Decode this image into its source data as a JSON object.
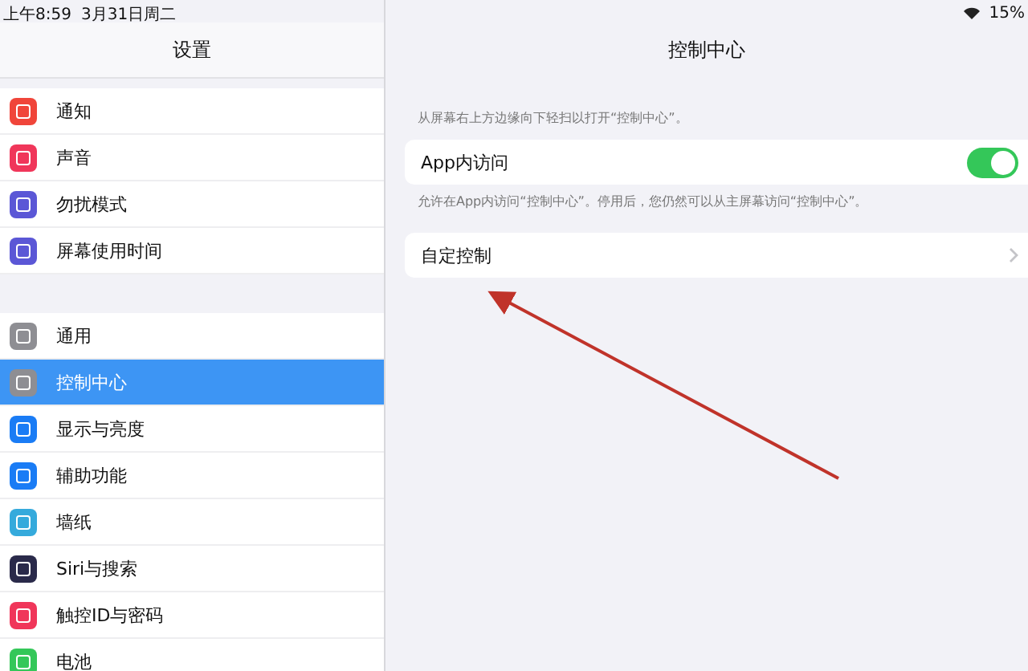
{
  "status_bar": {
    "time": "上午8:59",
    "date": "3月31日周二",
    "battery": "15%"
  },
  "sidebar": {
    "title": "设置",
    "groups": [
      [
        {
          "label": "通知",
          "color": "#f0453a",
          "selected": false
        },
        {
          "label": "声音",
          "color": "#f0365a",
          "selected": false
        },
        {
          "label": "勿扰模式",
          "color": "#5b57d6",
          "selected": false
        },
        {
          "label": "屏幕使用时间",
          "color": "#5b57d6",
          "selected": false
        }
      ],
      [
        {
          "label": "通用",
          "color": "#8e8e93",
          "selected": false
        },
        {
          "label": "控制中心",
          "color": "#8e8e93",
          "selected": true
        },
        {
          "label": "显示与亮度",
          "color": "#1a7cf5",
          "selected": false
        },
        {
          "label": "辅助功能",
          "color": "#1a7cf5",
          "selected": false
        },
        {
          "label": "墙纸",
          "color": "#35aadc",
          "selected": false
        },
        {
          "label": "Siri与搜索",
          "color": "#2a2a4a",
          "selected": false
        },
        {
          "label": "触控ID与密码",
          "color": "#f0365a",
          "selected": false
        },
        {
          "label": "电池",
          "color": "#34c759",
          "selected": false
        }
      ]
    ]
  },
  "detail": {
    "title": "控制中心",
    "description": "从屏幕右上方边缘向下轻扫以打开“控制中心”。",
    "toggle": {
      "label": "App内访问",
      "on": true
    },
    "toggle_footer": "允许在App内访问“控制中心”。停用后，您仍然可以从主屏幕访问“控制中心”。",
    "link": {
      "label": "自定控制"
    }
  }
}
